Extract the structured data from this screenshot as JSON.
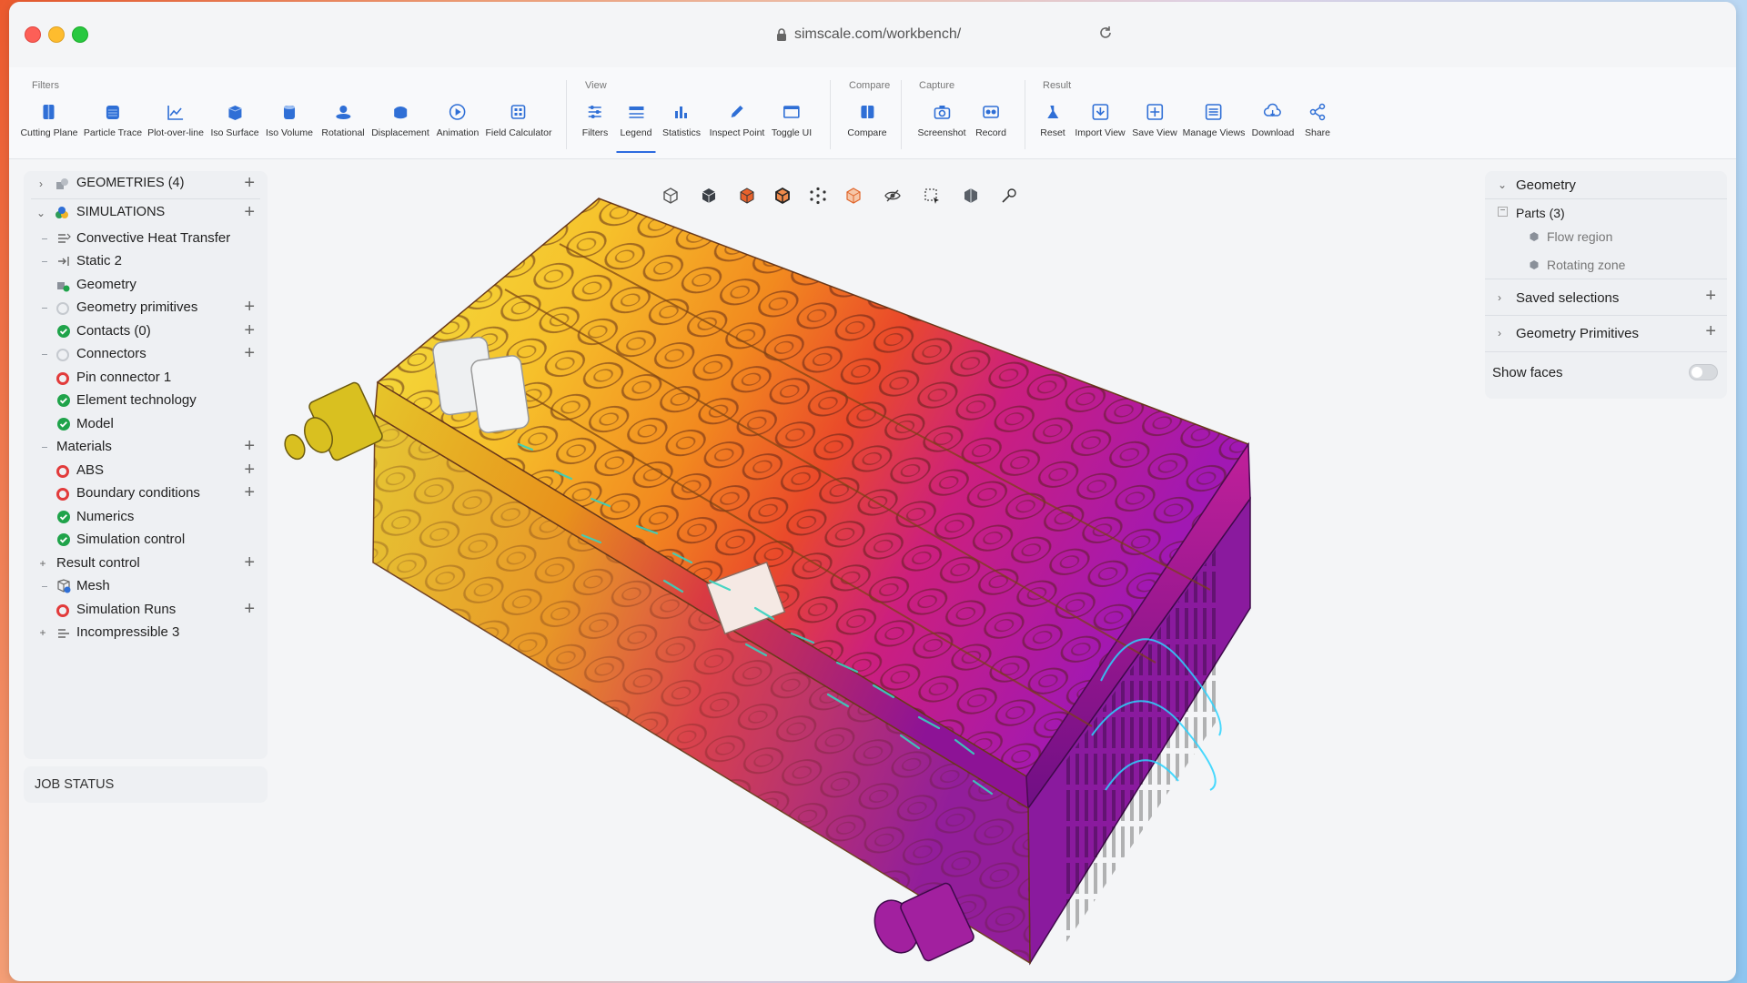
{
  "browser": {
    "url": "simscale.com/workbench/"
  },
  "toolbar": {
    "groups": [
      {
        "label": "Filters",
        "items": [
          {
            "label": "Cutting Plane",
            "icon": "cutting-plane-icon"
          },
          {
            "label": "Particle Trace",
            "icon": "particle-trace-icon"
          },
          {
            "label": "Plot-over-line",
            "icon": "plot-over-line-icon"
          },
          {
            "label": "Iso Surface",
            "icon": "iso-surface-icon"
          },
          {
            "label": "Iso Volume",
            "icon": "iso-volume-icon"
          },
          {
            "label": "Rotational",
            "icon": "rotational-icon"
          },
          {
            "label": "Displacement",
            "icon": "displacement-icon"
          },
          {
            "label": "Animation",
            "icon": "animation-icon"
          },
          {
            "label": "Field Calculator",
            "icon": "field-calculator-icon"
          }
        ]
      },
      {
        "label": "View",
        "items": [
          {
            "label": "Filters",
            "icon": "filters-icon"
          },
          {
            "label": "Legend",
            "icon": "legend-icon",
            "active": true
          },
          {
            "label": "Statistics",
            "icon": "statistics-icon"
          },
          {
            "label": "Inspect Point",
            "icon": "inspect-point-icon"
          },
          {
            "label": "Toggle UI",
            "icon": "toggle-ui-icon"
          }
        ]
      },
      {
        "label": "Compare",
        "items": [
          {
            "label": "Compare",
            "icon": "compare-icon"
          }
        ]
      },
      {
        "label": "Capture",
        "items": [
          {
            "label": "Screenshot",
            "icon": "camera-icon"
          },
          {
            "label": "Record",
            "icon": "record-icon"
          }
        ]
      },
      {
        "label": "Result",
        "items": [
          {
            "label": "Reset",
            "icon": "reset-icon"
          },
          {
            "label": "Import View",
            "icon": "import-view-icon"
          },
          {
            "label": "Save View",
            "icon": "save-view-icon"
          },
          {
            "label": "Manage Views",
            "icon": "manage-views-icon"
          },
          {
            "label": "Download",
            "icon": "download-icon"
          },
          {
            "label": "Share",
            "icon": "share-icon"
          }
        ]
      }
    ]
  },
  "tree": {
    "geometries": "GEOMETRIES (4)",
    "simulations": "SIMULATIONS",
    "items": [
      {
        "label": "Convective Heat Transfer",
        "status": "analysis"
      },
      {
        "label": "Static 2",
        "status": "static"
      },
      {
        "label": "Geometry",
        "status": "geometry"
      },
      {
        "label": "Geometry primitives",
        "status": "empty"
      },
      {
        "label": "Contacts (0)",
        "status": "ok"
      },
      {
        "label": "Connectors",
        "status": "empty"
      },
      {
        "label": "Pin connector 1",
        "status": "error"
      },
      {
        "label": "Element technology",
        "status": "ok"
      },
      {
        "label": "Model",
        "status": "ok"
      },
      {
        "label": "Materials",
        "status": "none"
      },
      {
        "label": "ABS",
        "status": "error"
      },
      {
        "label": "Boundary conditions",
        "status": "error"
      },
      {
        "label": "Numerics",
        "status": "ok"
      },
      {
        "label": "Simulation control",
        "status": "ok"
      },
      {
        "label": "Result control",
        "status": "none"
      },
      {
        "label": "Mesh",
        "status": "mesh"
      },
      {
        "label": "Simulation Runs",
        "status": "error"
      },
      {
        "label": "Incompressible 3",
        "status": "incompressible"
      }
    ]
  },
  "job_status": "JOB STATUS",
  "right_panel": {
    "geometry": "Geometry",
    "parts": "Parts (3)",
    "part_items": [
      "Flow region",
      "Rotating zone"
    ],
    "saved_selections": "Saved selections",
    "geometry_primitives": "Geometry Primitives",
    "show_faces": "Show faces",
    "show_faces_on": false
  },
  "colors": {
    "accent": "#2d6be0",
    "ok": "#1fa34a",
    "error": "#e23b3b",
    "toolbar_icon": "#2f6fd6"
  }
}
